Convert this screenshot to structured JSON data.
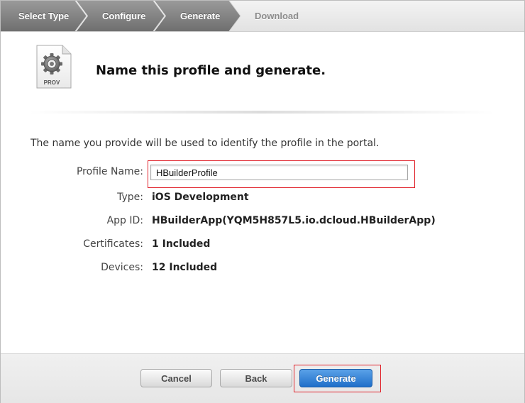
{
  "steps": [
    {
      "label": "Select Type",
      "state": "completed"
    },
    {
      "label": "Configure",
      "state": "completed"
    },
    {
      "label": "Generate",
      "state": "current"
    },
    {
      "label": "Download",
      "state": "upcoming"
    }
  ],
  "header": {
    "icon_label": "PROV",
    "title": "Name this profile and generate."
  },
  "form": {
    "intro": "The name you provide will be used to identify the profile in the portal.",
    "profile_name_label": "Profile Name:",
    "profile_name_value": "HBuilderProfile",
    "fields": [
      {
        "label": "Type:",
        "value": "iOS Development"
      },
      {
        "label": "App ID:",
        "value": "HBuilderApp(YQM5H857L5.io.dcloud.HBuilderApp)"
      },
      {
        "label": "Certificates:",
        "value": "1 Included"
      },
      {
        "label": "Devices:",
        "value": "12 Included"
      }
    ]
  },
  "footer": {
    "cancel_label": "Cancel",
    "back_label": "Back",
    "generate_label": "Generate"
  },
  "colors": {
    "highlight": "#e0232b",
    "step_active": "#7d7d7d",
    "primary_button": "#2b7bd3"
  }
}
